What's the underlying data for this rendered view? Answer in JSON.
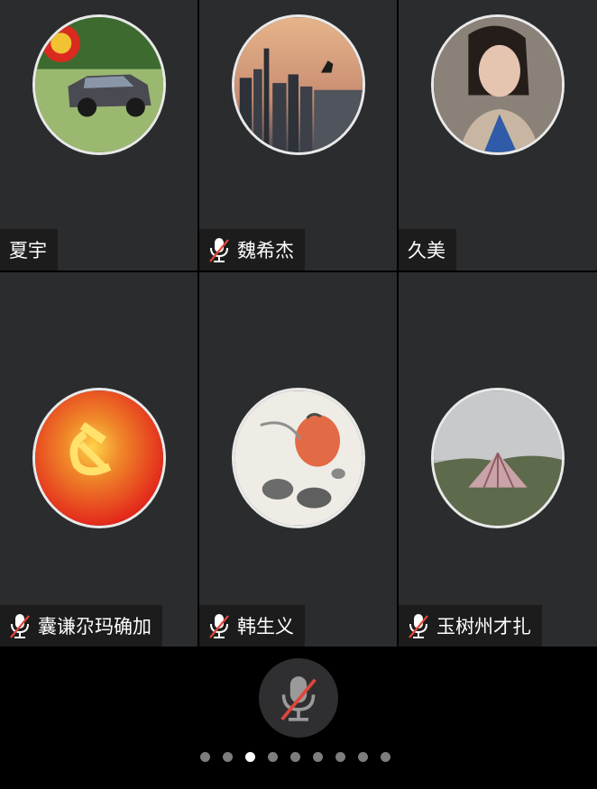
{
  "participants": [
    {
      "name": "夏宇",
      "muted": false,
      "avatar_icon": "car-grass-avatar"
    },
    {
      "name": "魏希杰",
      "muted": true,
      "avatar_icon": "city-sunset-avatar"
    },
    {
      "name": "久美",
      "muted": false,
      "avatar_icon": "woman-portrait-avatar"
    },
    {
      "name": "囊谦尕玛确加",
      "muted": true,
      "avatar_icon": "hammer-sickle-avatar"
    },
    {
      "name": "韩生义",
      "muted": true,
      "avatar_icon": "pumpkin-painting-avatar"
    },
    {
      "name": "玉树州才扎",
      "muted": true,
      "avatar_icon": "tent-landscape-avatar"
    }
  ],
  "pagination": {
    "total": 9,
    "active_index": 2
  },
  "colors": {
    "tile_bg": "#2b2c2e",
    "muted_red": "#e0463b",
    "tag_bg": "#1c1c1d"
  }
}
